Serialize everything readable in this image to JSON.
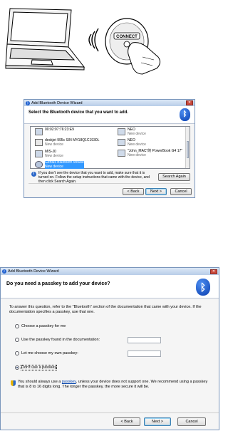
{
  "illustration": {
    "connect_label": "CONNECT"
  },
  "dialog1": {
    "title": "Add Bluetooth Device Wizard",
    "heading": "Select the Bluetooth device that you want to add.",
    "devices": [
      {
        "name": "00:02:07:76:23:E9",
        "sub": ""
      },
      {
        "name": "NEO",
        "sub": "New device"
      },
      {
        "name": "deskjet 995c S/N MY18Q1C1930L",
        "sub": "New device"
      },
      {
        "name": "NEO",
        "sub": "New device"
      },
      {
        "name": "MIS-J0",
        "sub": "New device"
      },
      {
        "name": "\"John_MAC\"的 PowerBook G4 17\"",
        "sub": "New device"
      },
      {
        "name": "Genius Bluetooth Mouse",
        "sub": "New device"
      }
    ],
    "info_text": "If you don't see the device that you want to add, make sure that it is turned on. Follow the setup instructions that came with the device, and then click Search Again.",
    "search_again": "Search Again",
    "back": "< Back",
    "next": "Next >",
    "cancel": "Cancel"
  },
  "dialog2": {
    "title": "Add Bluetooth Device Wizard",
    "heading": "Do you need a passkey to add your device?",
    "body": "To answer this question, refer to the \"Bluetooth\" section of the documentation that came with your device. If the documentation specifies a passkey, use that one.",
    "options": [
      "Choose a passkey for me",
      "Use the passkey found in the documentation:",
      "Let me choose my own passkey:",
      "Don't use a passkey"
    ],
    "warning_pre": "You should always use a",
    "warning_link": "passkey",
    "warning_post": ", unless your device does not support one. We recommend using a passkey that is 8 to 16 digits long. The longer the passkey, the more secure it will be.",
    "back": "< Back",
    "next": "Next >",
    "cancel": "Cancel"
  }
}
